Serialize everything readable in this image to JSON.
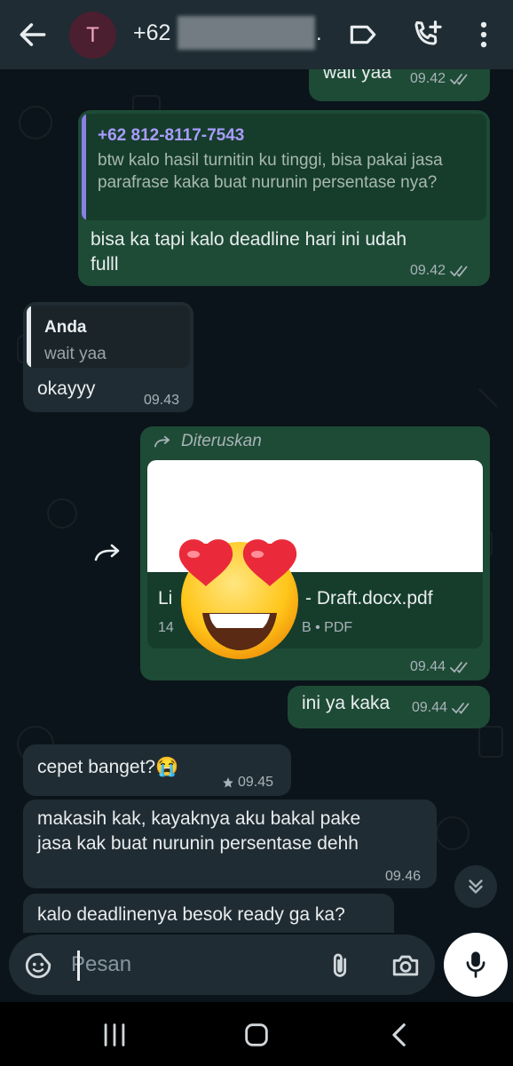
{
  "header": {
    "avatar_letter": "T",
    "contact_prefix": "+62",
    "contact_suffix": "."
  },
  "messages": [
    {
      "id": "m1",
      "direction": "out",
      "text": "wait yaa",
      "time": "09.42",
      "status": "read"
    },
    {
      "id": "m2",
      "direction": "out",
      "quote": {
        "author": "+62 812-8117-7543",
        "text": "btw kalo hasil turnitin ku tinggi, bisa pakai jasa parafrase kaka buat nurunin persentase nya?"
      },
      "text_line1": "bisa ka tapi kalo deadline hari ini udah",
      "text_line2": "fulll",
      "time": "09.42",
      "status": "read"
    },
    {
      "id": "m3",
      "direction": "in",
      "quote": {
        "author": "Anda",
        "text": "wait yaa"
      },
      "text": "okayyy",
      "time": "09.43"
    },
    {
      "id": "m4",
      "direction": "out",
      "forwarded_label": "Diteruskan",
      "document": {
        "name_start": "Li",
        "name_end": "- Draft.docx.pdf",
        "info_start": "14",
        "info_end": "B • PDF"
      },
      "time": "09.44",
      "status": "read"
    },
    {
      "id": "m5",
      "direction": "out",
      "text": "ini ya kaka",
      "time": "09.44",
      "status": "read"
    },
    {
      "id": "m6",
      "direction": "in",
      "text": "cepet banget?😭",
      "time": "09.45",
      "starred": true
    },
    {
      "id": "m7",
      "direction": "in",
      "text_line1": "makasih kak, kayaknya aku bakal pake",
      "text_line2": "jasa kak buat nurunin persentase dehh",
      "time": "09.46"
    },
    {
      "id": "m8",
      "direction": "in",
      "text": "kalo deadlinenya besok ready ga ka?"
    }
  ],
  "composer": {
    "placeholder": "Pesan"
  },
  "icons": {
    "back": "arrow-left-icon",
    "label": "label-tag-icon",
    "call": "add-call-icon",
    "menu": "more-vert-icon",
    "emoji": "sticker-icon",
    "attach": "paperclip-icon",
    "camera": "camera-icon",
    "mic": "mic-icon",
    "scroll": "double-chevron-down-icon",
    "forward": "forward-icon"
  },
  "colors": {
    "outgoing": "#1e4b36",
    "incoming": "#202c33",
    "quote_author_out": "#a78bfa",
    "accent_green": "#25d366"
  }
}
